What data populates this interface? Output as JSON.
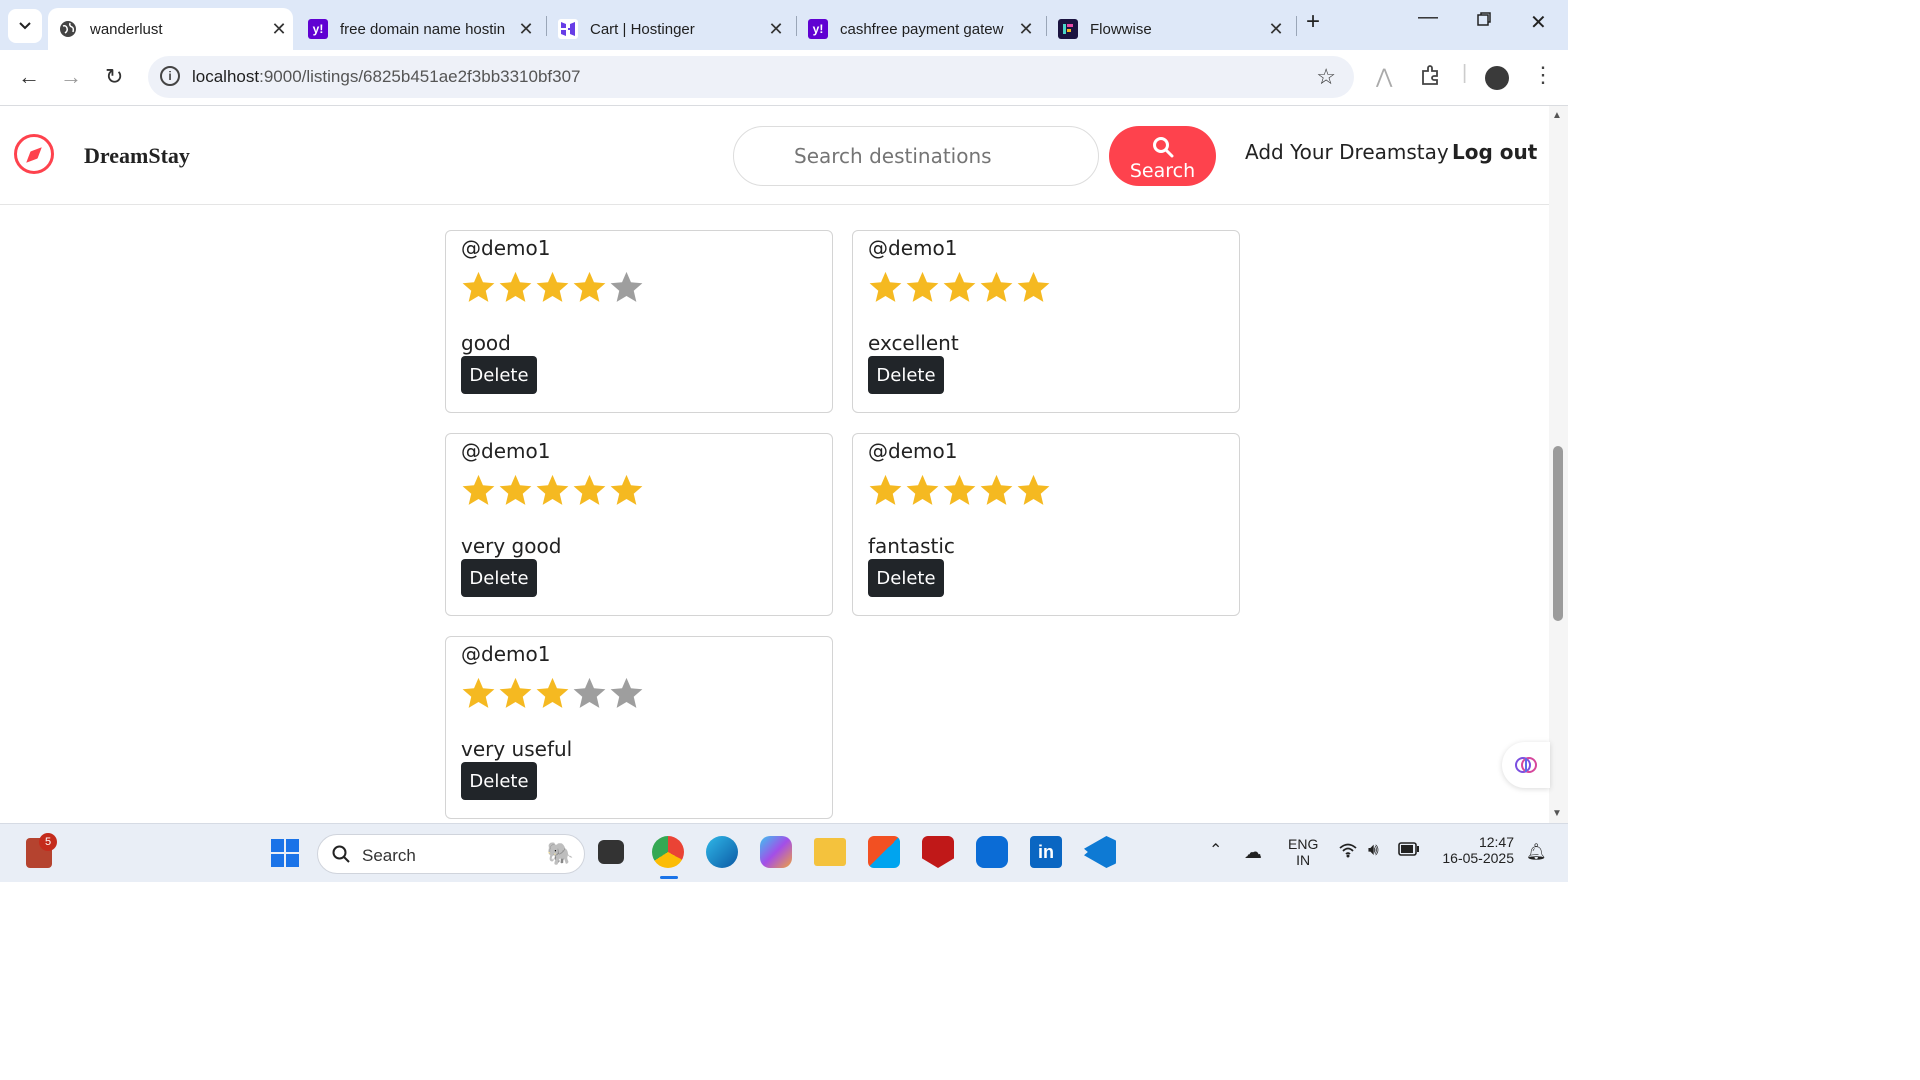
{
  "browser": {
    "tabs": [
      {
        "title": "wanderlust",
        "active": true,
        "icon": "globe-icon"
      },
      {
        "title": "free domain name hostin",
        "active": false,
        "icon": "yahoo-icon"
      },
      {
        "title": "Cart | Hostinger",
        "active": false,
        "icon": "hostinger-icon"
      },
      {
        "title": "cashfree payment gatew",
        "active": false,
        "icon": "yahoo-icon"
      },
      {
        "title": "Flowwise",
        "active": false,
        "icon": "flowwise-icon"
      }
    ],
    "url_host": "localhost",
    "url_rest": ":9000/listings/6825b451ae2f3bb3310bf307"
  },
  "site": {
    "brand": "DreamStay",
    "search_placeholder": "Search destinations",
    "search_button": "Search",
    "nav_add": "Add Your Dreamstay",
    "nav_logout": "Log out",
    "accent": "#fe424d"
  },
  "reviews": [
    {
      "author": "@demo1",
      "rating": 4,
      "comment": "good",
      "delete_label": "Delete"
    },
    {
      "author": "@demo1",
      "rating": 5,
      "comment": "excellent",
      "delete_label": "Delete"
    },
    {
      "author": "@demo1",
      "rating": 5,
      "comment": "very good",
      "delete_label": "Delete"
    },
    {
      "author": "@demo1",
      "rating": 5,
      "comment": "fantastic",
      "delete_label": "Delete"
    },
    {
      "author": "@demo1",
      "rating": 3,
      "comment": "very useful",
      "delete_label": "Delete"
    }
  ],
  "colors": {
    "star_on": "#f5b921",
    "star_off": "#9e9e9e"
  },
  "taskbar": {
    "search_label": "Search",
    "notification_count": "5",
    "lang_line1": "ENG",
    "lang_line2": "IN",
    "time": "12:47",
    "date": "16-05-2025"
  }
}
